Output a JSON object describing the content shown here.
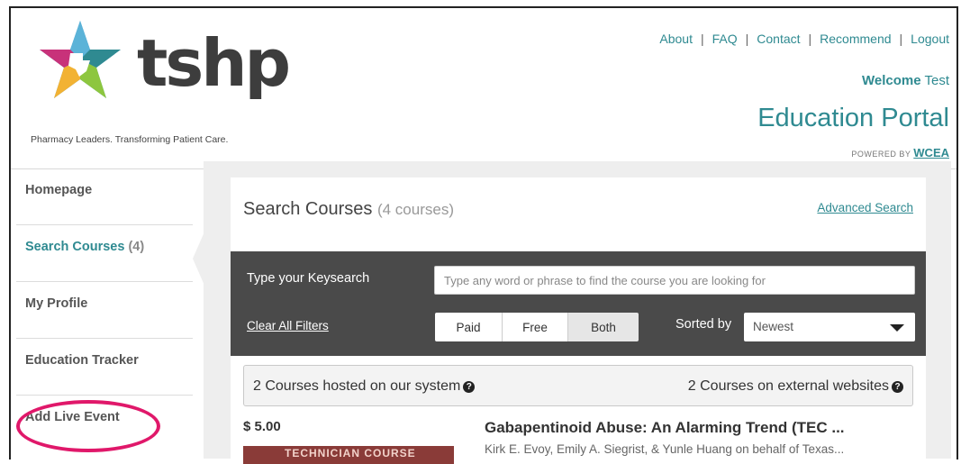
{
  "header": {
    "logo_text": "tshp",
    "tagline": "Pharmacy Leaders. Transforming Patient Care.",
    "links": [
      "About",
      "FAQ",
      "Contact",
      "Recommend",
      "Logout"
    ],
    "welcome_label": "Welcome",
    "welcome_user": "Test",
    "portal_title": "Education Portal",
    "powered_by": "POWERED BY",
    "powered_brand": "WCEA"
  },
  "sidebar": {
    "items": [
      {
        "label": "Homepage"
      },
      {
        "label": "Search Courses",
        "count": "(4)"
      },
      {
        "label": "My Profile"
      },
      {
        "label": "Education Tracker"
      },
      {
        "label": "Add Live Event"
      }
    ]
  },
  "search": {
    "title": "Search Courses",
    "count": "(4 courses)",
    "advanced_link": "Advanced Search",
    "key_label": "Type your Keysearch",
    "key_placeholder": "Type any word or phrase to find the course you are looking for",
    "clear_filters": "Clear All Filters",
    "filters": [
      "Paid",
      "Free",
      "Both"
    ],
    "selected_filter": "Both",
    "sorted_label": "Sorted by",
    "sort_value": "Newest"
  },
  "info": {
    "hosted": "2 Courses hosted on our system",
    "external": "2 Courses on external websites"
  },
  "course": {
    "price": "$ 5.00",
    "thumb_text": "TECHNICIAN COURSE",
    "title": "Gabapentinoid Abuse: An Alarming Trend (TEC ...",
    "authors": "Kirk E. Evoy, Emily A. Siegrist, & Yunle Huang on behalf of Texas..."
  },
  "colors": {
    "accent": "#2f8a91",
    "highlight_ring": "#e0186a",
    "dark_panel": "#4a4a4a"
  }
}
